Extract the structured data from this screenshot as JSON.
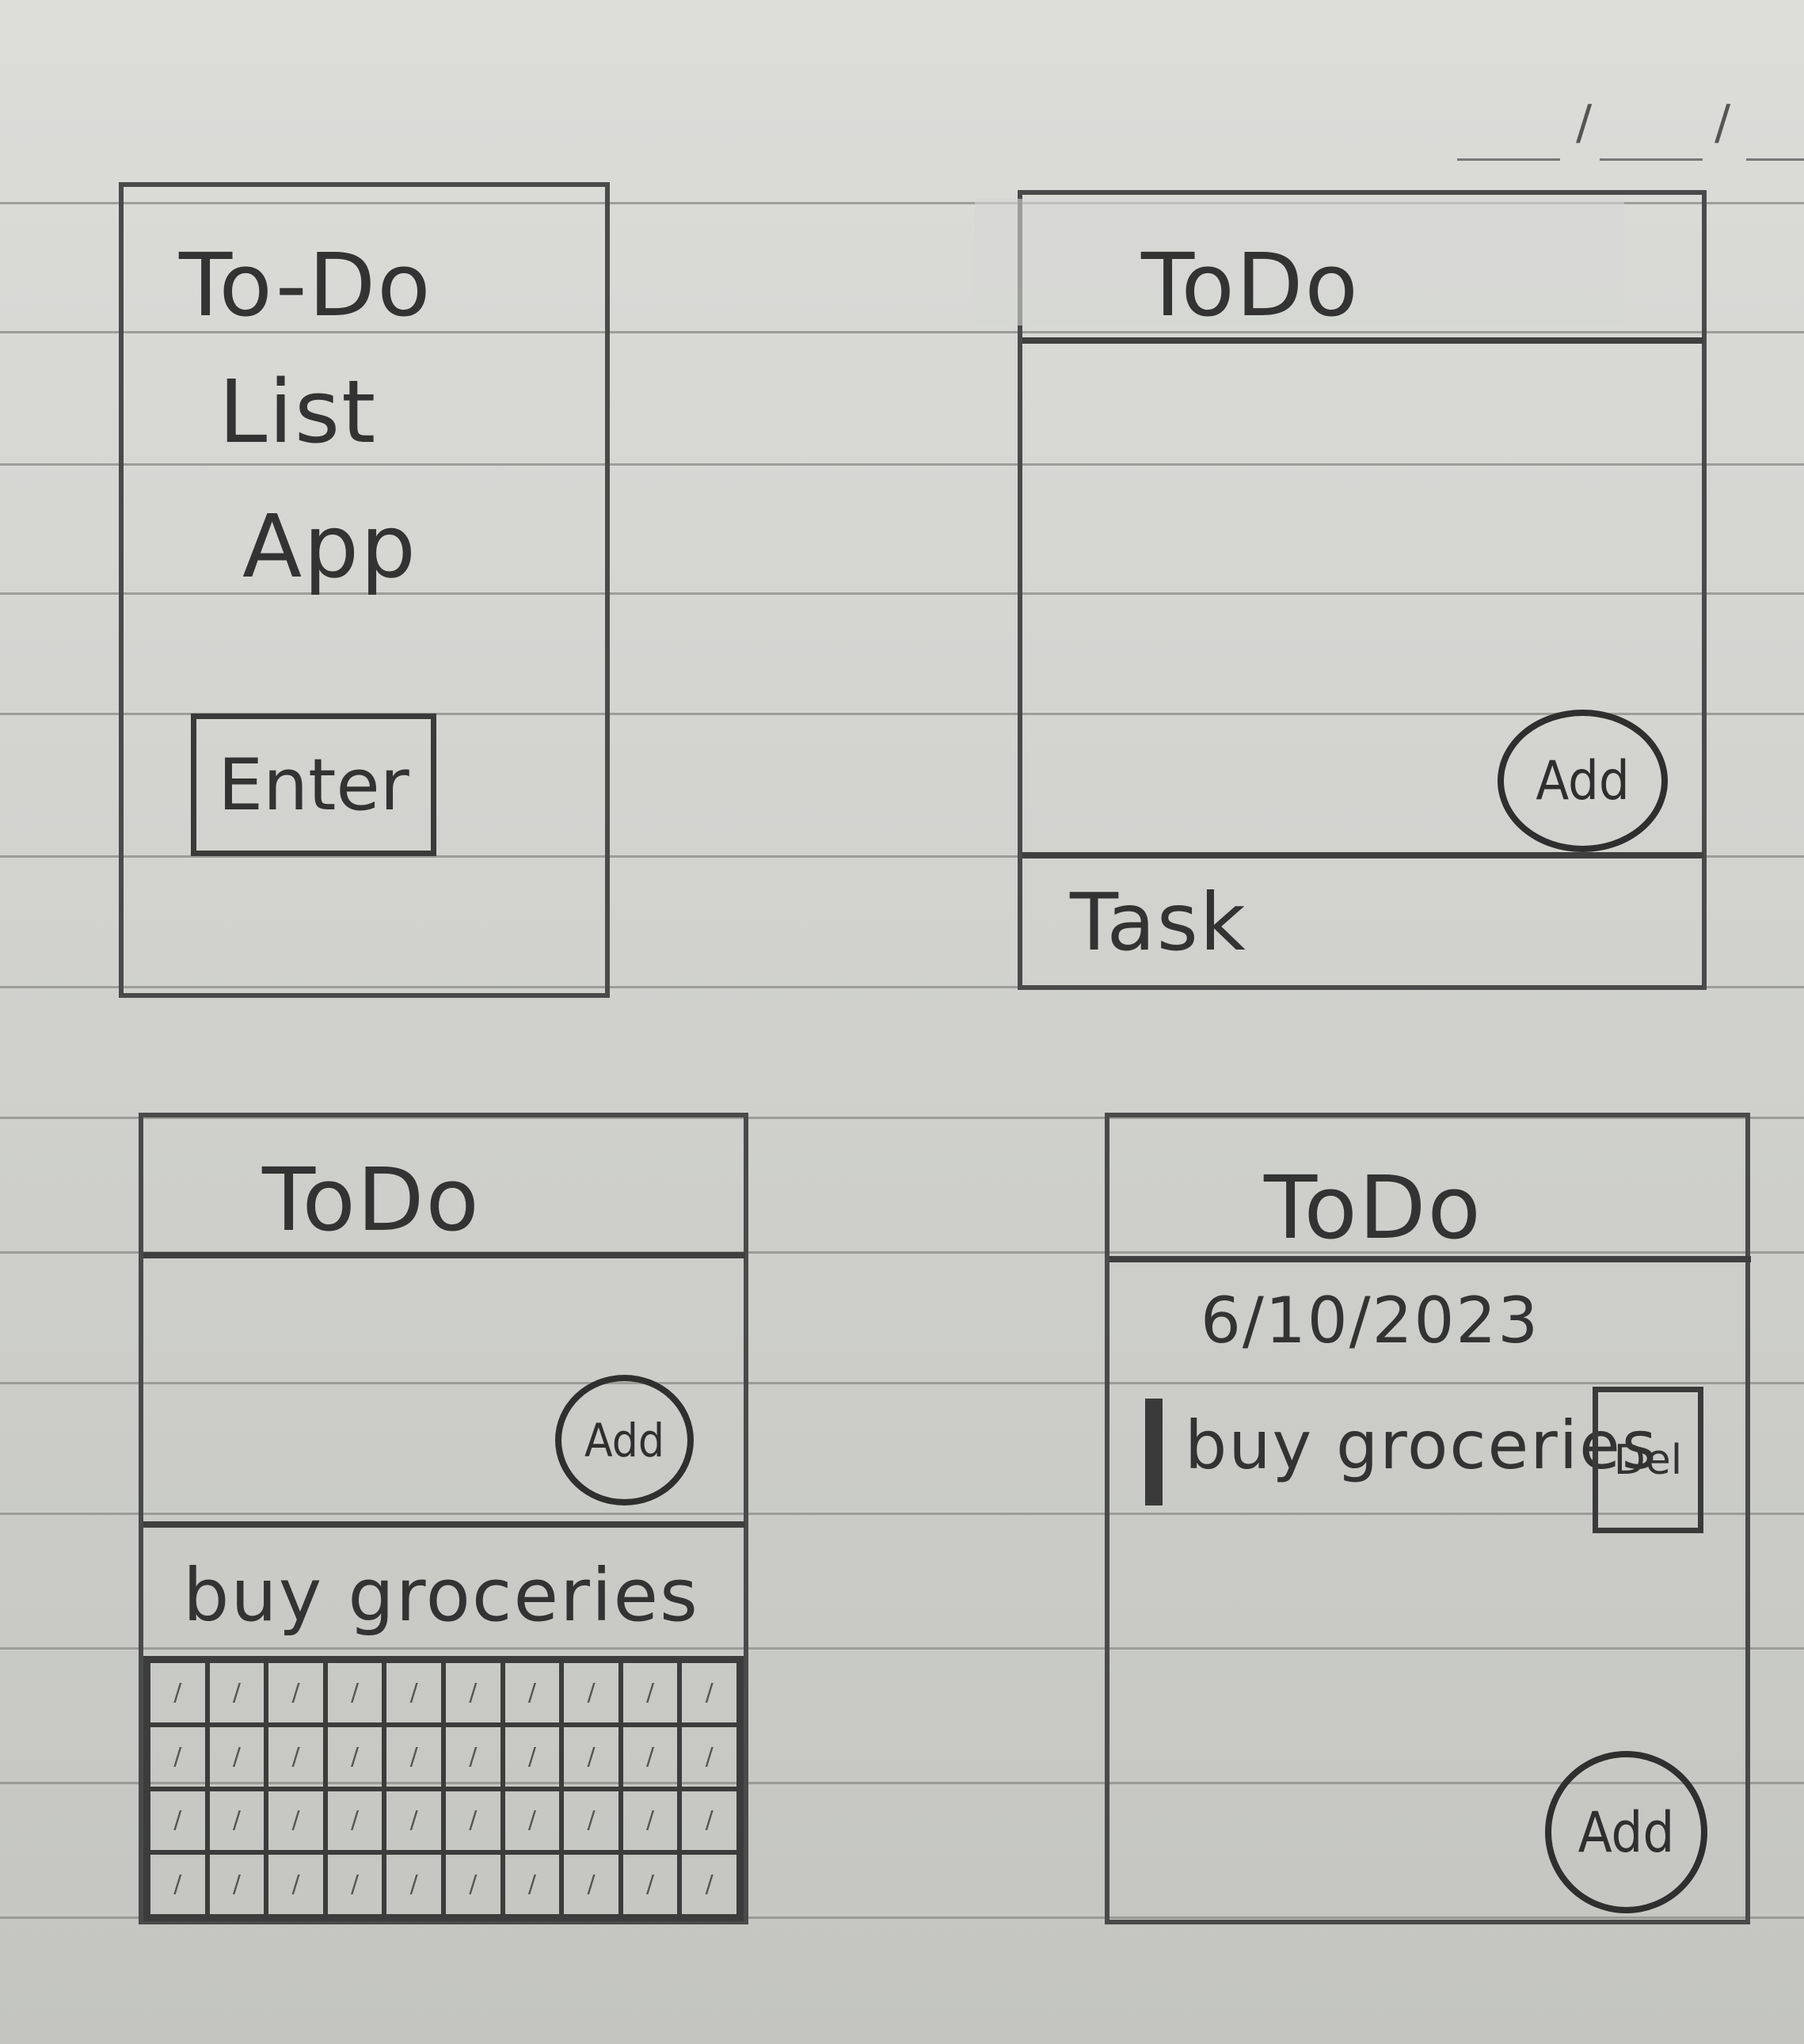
{
  "screen1": {
    "title_lines": [
      "To-Do",
      "List",
      "App"
    ],
    "enter_label": "Enter"
  },
  "screen2": {
    "header": "ToDo",
    "add_label": "Add",
    "task_placeholder": "Task"
  },
  "screen3": {
    "header": "ToDo",
    "add_label": "Add",
    "task_value": "buy groceries",
    "calendar_rows": 4,
    "calendar_cols": 10
  },
  "screen4": {
    "header": "ToDo",
    "date": "6/10/2023",
    "item_text": "buy groceries",
    "delete_label": "Del",
    "add_label": "Add"
  }
}
